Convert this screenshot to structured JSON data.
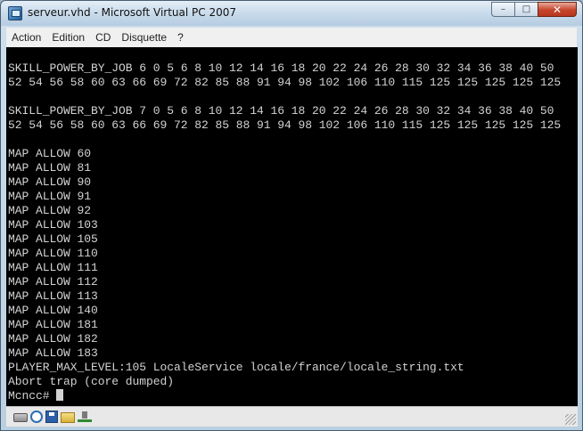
{
  "window": {
    "title": "serveur.vhd - Microsoft Virtual PC 2007",
    "caption": {
      "minimize": "–",
      "maximize": "□",
      "close": "✕"
    }
  },
  "menubar": {
    "items": [
      "Action",
      "Edition",
      "CD",
      "Disquette",
      "?"
    ]
  },
  "console": {
    "lines": [
      "SKILL_POWER_BY_JOB 6 0 5 6 8 10 12 14 16 18 20 22 24 26 28 30 32 34 36 38 40 50",
      "52 54 56 58 60 63 66 69 72 82 85 88 91 94 98 102 106 110 115 125 125 125 125 125",
      "",
      "SKILL_POWER_BY_JOB 7 0 5 6 8 10 12 14 16 18 20 22 24 26 28 30 32 34 36 38 40 50",
      "52 54 56 58 60 63 66 69 72 82 85 88 91 94 98 102 106 110 115 125 125 125 125 125",
      "",
      "MAP ALLOW 60",
      "MAP ALLOW 81",
      "MAP ALLOW 90",
      "MAP ALLOW 91",
      "MAP ALLOW 92",
      "MAP ALLOW 103",
      "MAP ALLOW 105",
      "MAP ALLOW 110",
      "MAP ALLOW 111",
      "MAP ALLOW 112",
      "MAP ALLOW 113",
      "MAP ALLOW 140",
      "MAP ALLOW 181",
      "MAP ALLOW 182",
      "MAP ALLOW 183",
      "PLAYER_MAX_LEVEL:105 LocaleService locale/france/locale_string.txt",
      "Abort trap (core dumped)"
    ],
    "prompt": "Mcncc# "
  },
  "statusbar": {
    "icons": [
      "hard-disk-icon",
      "clock-icon",
      "floppy-icon",
      "shared-folder-icon",
      "network-icon"
    ]
  },
  "colors": {
    "console_bg": "#000000",
    "console_fg": "#d2d2d2",
    "menubar_bg": "#f0f0f0",
    "close_button": "#c7452d"
  }
}
